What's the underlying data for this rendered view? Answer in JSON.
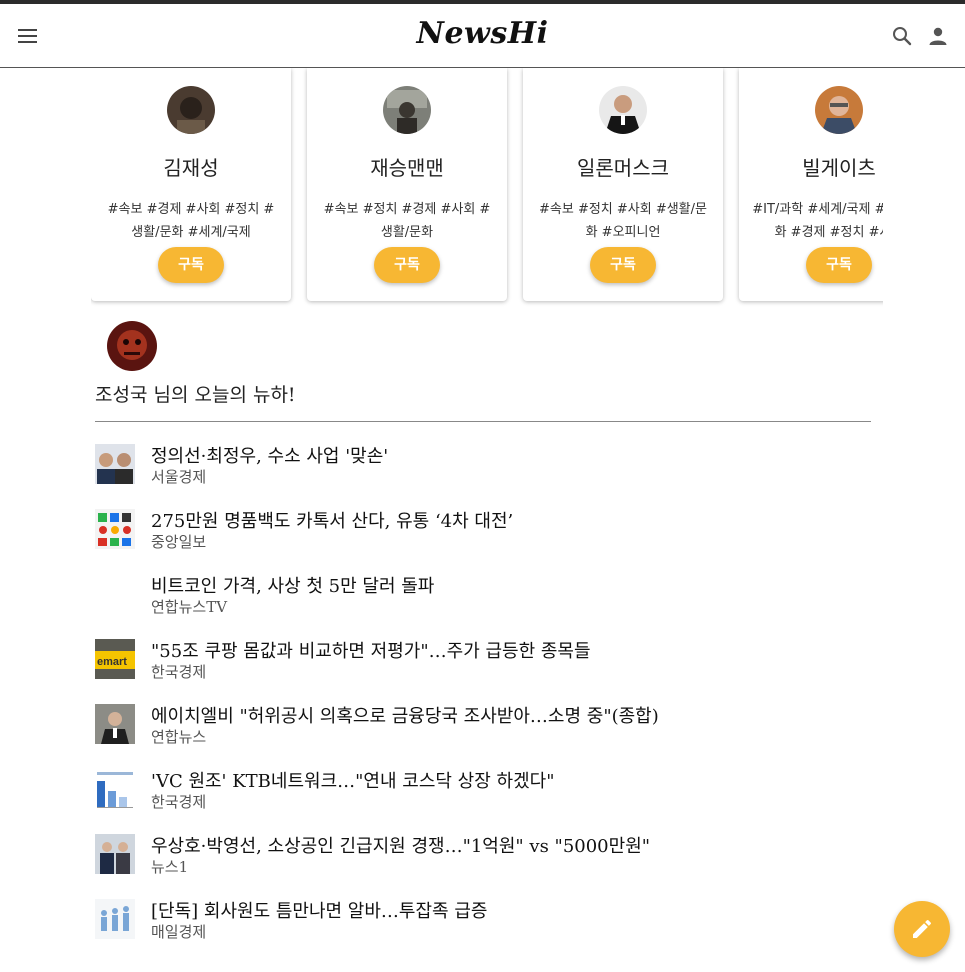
{
  "header": {
    "logo": "NewsHi",
    "menu_icon": "hamburger-menu-icon",
    "search_icon": "search-icon",
    "account_icon": "person-icon"
  },
  "recommended": [
    {
      "name": "김재성",
      "tags": "#속보 #경제 #사회 #정치 #생활/문화 #세계/국제",
      "button": "구독"
    },
    {
      "name": "재승맨맨",
      "tags": "#속보 #정치 #경제 #사회 #생활/문화",
      "button": "구독"
    },
    {
      "name": "일론머스크",
      "tags": "#속보 #정치 #사회 #생활/문화 #오피니언",
      "button": "구독"
    },
    {
      "name": "빌게이츠",
      "tags": "#IT/과학 #세계/국제 #생활/문화 #경제 #정치 #사회",
      "button": "구독"
    }
  ],
  "user": {
    "greeting": "조성국 님의 오늘의 뉴하!"
  },
  "news": [
    {
      "title": "정의선·최정우, 수소 사업 '맞손'",
      "source": "서울경제"
    },
    {
      "title": "275만원 명품백도 카톡서 산다, 유통 ‘4차 대전’",
      "source": "중앙일보"
    },
    {
      "title": "비트코인 가격, 사상 첫 5만 달러 돌파",
      "source": "연합뉴스TV"
    },
    {
      "title": "\"55조 쿠팡 몸값과 비교하면 저평가\"…주가 급등한 종목들",
      "source": "한국경제"
    },
    {
      "title": "에이치엘비 \"허위공시 의혹으로 금융당국 조사받아…소명 중\"(종합)",
      "source": "연합뉴스"
    },
    {
      "title": "'VC 원조' KTB네트워크…\"연내 코스닥 상장 하겠다\"",
      "source": "한국경제"
    },
    {
      "title": "우상호·박영선, 소상공인 긴급지원 경쟁…\"1억원\" vs \"5000만원\"",
      "source": "뉴스1"
    },
    {
      "title": "[단독] 회사원도 틈만나면 알바…투잡족 급증",
      "source": "매일경제"
    }
  ],
  "fab_icon": "pencil-icon",
  "colors": {
    "accent": "#f7b733",
    "header_line": "#2b2b2b"
  }
}
